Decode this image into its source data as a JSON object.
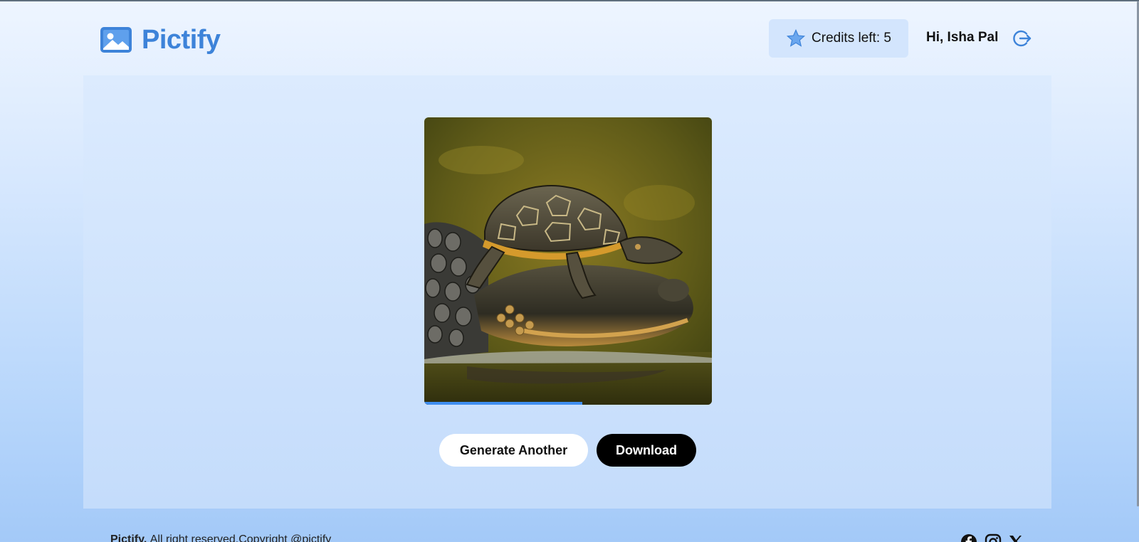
{
  "brand": {
    "name": "Pictify",
    "logo_icon": "image-icon",
    "color": "#3d83d9"
  },
  "header": {
    "credits_label": "Credits left: 5",
    "credits_icon": "star-icon",
    "greeting": "Hi, Isha Pal",
    "logout_icon": "logout-icon"
  },
  "result": {
    "image_subject": "Turtle resting on an alligator in water",
    "load_progress": 0.55
  },
  "actions": {
    "generate_label": "Generate Another",
    "download_label": "Download"
  },
  "footer": {
    "brand": "Pictify.",
    "text": "All right reserved.Copyright @pictify",
    "social_icons": [
      "facebook-icon",
      "instagram-icon",
      "x-icon"
    ]
  },
  "colors": {
    "accent": "#3f8ef0",
    "download_bg": "#000000",
    "credits_bg": "#d3e5fd"
  }
}
